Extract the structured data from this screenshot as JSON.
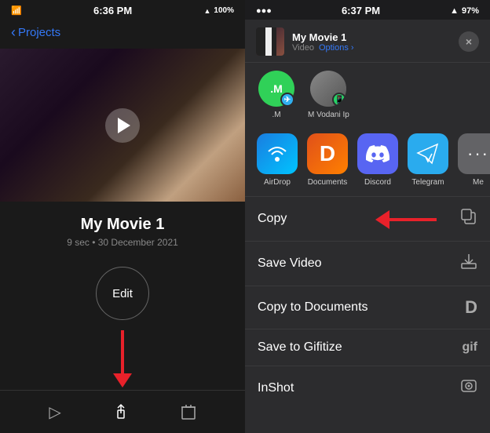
{
  "left": {
    "status_bar": {
      "time": "6:36 PM",
      "battery": "100%"
    },
    "nav": {
      "back_label": "Projects"
    },
    "movie": {
      "title": "My Movie 1",
      "meta": "9 sec • 30 December 2021"
    },
    "edit_button": "Edit",
    "toolbar": {
      "play_icon": "▶",
      "share_icon": "⬆",
      "delete_icon": "🗑"
    }
  },
  "right": {
    "status_bar": {
      "time": "6:37 PM",
      "battery": "97%"
    },
    "share_sheet": {
      "title": "My Movie 1",
      "video_label": "Video",
      "options_label": "Options ›",
      "close_label": "×"
    },
    "contacts": [
      {
        "name": ".M",
        "initials": ".M",
        "color": "green",
        "badge": "✈"
      },
      {
        "name": "M Vodani Ip",
        "initials": "",
        "color": "gray"
      }
    ],
    "apps": [
      {
        "name": "AirDrop",
        "type": "airdrop",
        "symbol": "📡"
      },
      {
        "name": "Documents",
        "type": "documents",
        "symbol": "D"
      },
      {
        "name": "Discord",
        "type": "discord",
        "symbol": "💬"
      },
      {
        "name": "Telegram",
        "type": "telegram",
        "symbol": "✈"
      },
      {
        "name": "Me",
        "type": "more",
        "symbol": "···"
      }
    ],
    "actions": [
      {
        "label": "Copy",
        "icon": "copy"
      },
      {
        "label": "Save Video",
        "icon": "download"
      },
      {
        "label": "Copy to Documents",
        "icon": "doc"
      },
      {
        "label": "Save to Gifitize",
        "icon": "gif"
      },
      {
        "label": "InShot",
        "icon": "camera"
      }
    ]
  }
}
